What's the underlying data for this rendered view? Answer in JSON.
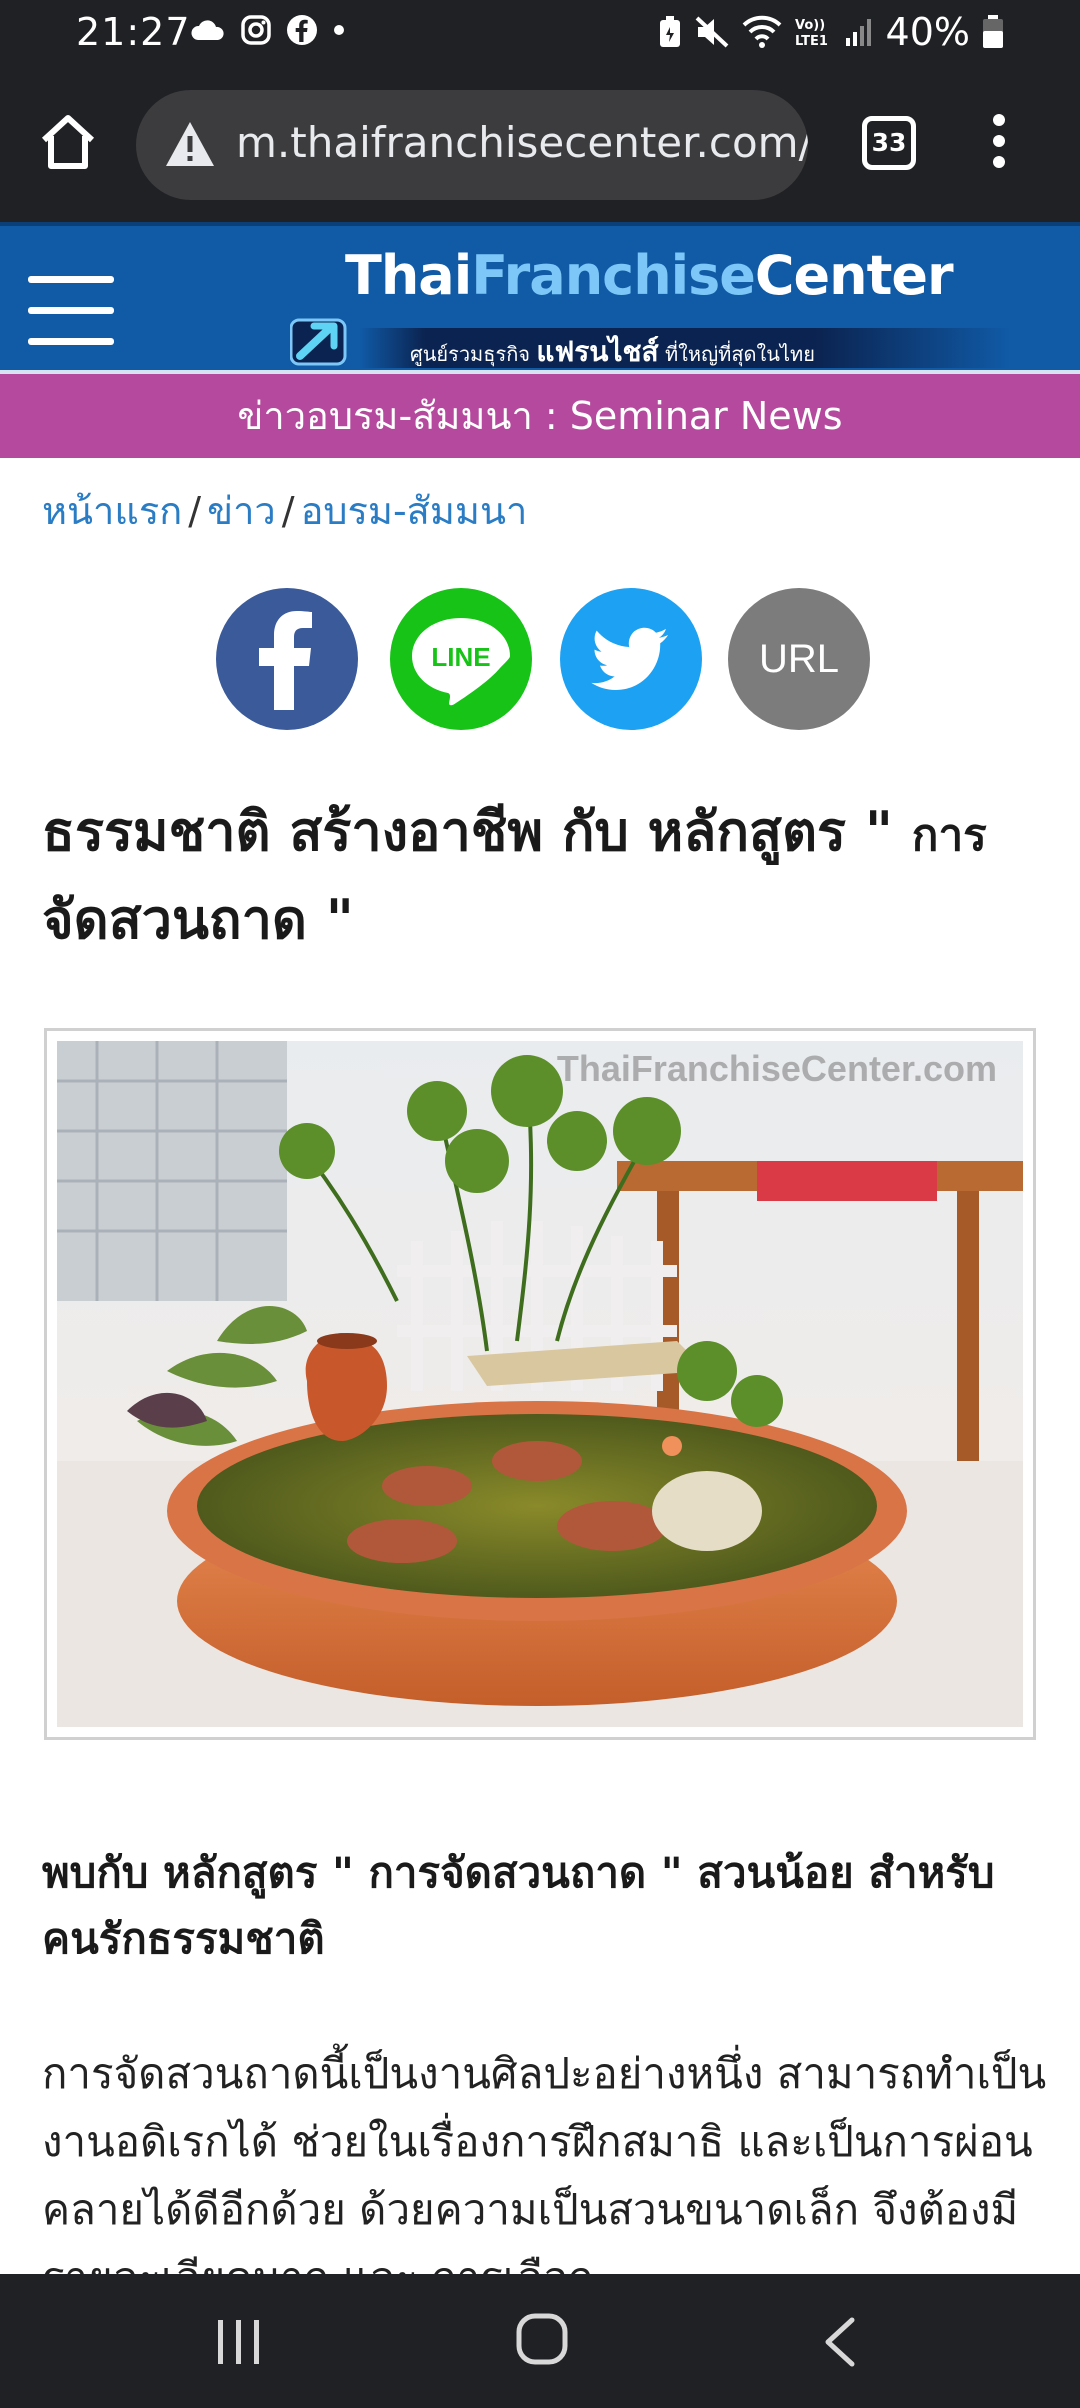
{
  "status_bar": {
    "time": "21:27",
    "left_icons": [
      "cloud-icon",
      "instagram-icon",
      "facebook-icon",
      "dot-icon"
    ],
    "right_icons": [
      "battery-saver-icon",
      "mute-icon",
      "wifi-icon",
      "volte-icon",
      "signal-icon",
      "battery-icon"
    ],
    "battery_text": "40%",
    "volte_label": "Vo)) LTE1"
  },
  "browser": {
    "url": "m.thaifranchisecenter.com/",
    "tab_count": "33",
    "home_icon": "home-icon",
    "security_icon": "warning-icon",
    "menu_icon": "more-vert-icon"
  },
  "site_header": {
    "logo_word_1": "Thai",
    "logo_word_2": "Franchise",
    "logo_word_3": "Center",
    "tagline_pre": "ศูนย์รวมธุรกิจ",
    "tagline_bold": "แฟรนไชส์",
    "tagline_post": "ที่ใหญ่ที่สุดในไทย",
    "menu_icon": "hamburger-icon",
    "colors": {
      "header_bg": "#105aa6",
      "logo_accent": "#7cc7f7"
    }
  },
  "category_banner": {
    "text": "ข่าวอบรม-สัมมนา : Seminar News",
    "color": "#b5499d"
  },
  "breadcrumb": {
    "items": [
      "หน้าแรก",
      "ข่าว",
      "อบรม-สัมมนา"
    ],
    "separator": "/"
  },
  "share": {
    "facebook_icon": "facebook-icon",
    "line_label": "LINE",
    "twitter_icon": "twitter-icon",
    "url_label": "URL"
  },
  "article": {
    "title_main": "ธรรมชาติ สร้างอาชีพ กับ หลักสูตร \"",
    "title_small_1": "การ",
    "title_line2": "จัดสวนถาด \"",
    "image_watermark": "ThaiFranchiseCenter.com",
    "subtitle": "พบกับ หลักสูตร \" การจัดสวนถาด \" สวนน้อย สำหรับ คนรักธรรมชาติ",
    "body": "การจัดสวนถาดนี้เป็นงานศิลปะอย่างหนึ่ง สามารถทำเป็นงานอดิเรกได้ ช่วยในเรื่องการฝึกสมาธิ และเป็นการผ่อนคลายได้ดีอีกด้วย ด้วยความเป็นสวนขนาดเล็ก จึงต้องมีรายละเอียดมาก และ การเลือก"
  },
  "nav_bar": {
    "recent_icon": "recent-apps-icon",
    "home_icon": "home-circle-icon",
    "back_icon": "back-chevron-icon"
  }
}
